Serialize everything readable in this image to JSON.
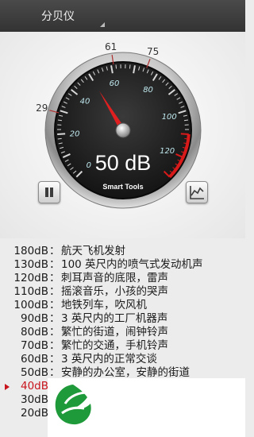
{
  "app": {
    "title": "分贝仪"
  },
  "meter": {
    "reading": "50 dB",
    "brand": "Smart Tools",
    "scale_labels": [
      "0",
      "20",
      "40",
      "60",
      "80",
      "100",
      "120"
    ],
    "min_marker": "29",
    "avg_marker": "61",
    "max_marker": "75",
    "needle_value_db": 50,
    "colors": {
      "needle": "#e02020",
      "face": "#1c1c1c",
      "scale_text": "#bfe8ee",
      "markers": "#b03030"
    }
  },
  "buttons": {
    "pause": "pause-icon",
    "chart": "line-chart-icon"
  },
  "reference": {
    "current_index": 10,
    "rows": [
      {
        "level": "180dB",
        "sep": "：",
        "desc": "航天飞机发射"
      },
      {
        "level": "130dB",
        "sep": "：",
        "desc": "100 英尺内的喷气式发动机声"
      },
      {
        "level": "120dB",
        "sep": "：",
        "desc": "刺耳声音的底限，雷声"
      },
      {
        "level": "110dB",
        "sep": "：",
        "desc": "摇滚音乐，小孩的哭声"
      },
      {
        "level": "100dB",
        "sep": "：",
        "desc": "地铁列车，吹风机"
      },
      {
        "level": "90dB",
        "sep": "：",
        "desc": "3 英尺内的工厂机器声"
      },
      {
        "level": "80dB",
        "sep": "：",
        "desc": "繁忙的街道，闹钟铃声"
      },
      {
        "level": "70dB",
        "sep": "：",
        "desc": "繁忙的交通，手机铃声"
      },
      {
        "level": "60dB",
        "sep": "：",
        "desc": "3 英尺内的正常交谈"
      },
      {
        "level": "50dB",
        "sep": "：",
        "desc": "安静的办公室，安静的街道"
      },
      {
        "level": "40dB",
        "sep": "",
        "desc": ""
      },
      {
        "level": "30dB",
        "sep": "",
        "desc": ""
      },
      {
        "level": "20dB",
        "sep": "",
        "desc": ""
      }
    ]
  },
  "ad": {
    "logo": "green-leaf-logo-icon"
  }
}
